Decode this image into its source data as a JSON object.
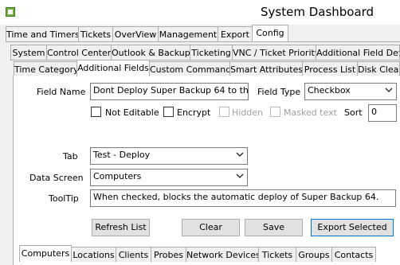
{
  "window": {
    "title": "System Dashboard"
  },
  "main_tabs": [
    {
      "label": "Time and Timers"
    },
    {
      "label": "Tickets"
    },
    {
      "label": "OverView"
    },
    {
      "label": "Management"
    },
    {
      "label": "Export"
    },
    {
      "label": "Config"
    }
  ],
  "config_tabs": [
    {
      "label": "System"
    },
    {
      "label": "Control Center"
    },
    {
      "label": "Outlook & Backup"
    },
    {
      "label": "Ticketing"
    },
    {
      "label": "VNC / Ticket Priority"
    },
    {
      "label": "Additional Field Defa"
    }
  ],
  "system_tabs": [
    {
      "label": "Time Category"
    },
    {
      "label": "Additional Fields"
    },
    {
      "label": "Custom Commands"
    },
    {
      "label": "Smart Attributes"
    },
    {
      "label": "Process List"
    },
    {
      "label": "Disk Clean"
    }
  ],
  "form": {
    "field_name_label": "Field Name",
    "field_name_value": "Dont Deploy Super Backup 64 to this wo",
    "field_type_label": "Field Type",
    "field_type_value": "Checkbox",
    "not_editable_label": "Not Editable",
    "encrypt_label": "Encrypt",
    "hidden_label": "Hidden",
    "masked_text_label": "Masked text",
    "sort_label": "Sort",
    "sort_value": "0",
    "tab_label": "Tab",
    "tab_value": "Test - Deploy",
    "data_screen_label": "Data Screen",
    "data_screen_value": "Computers",
    "tooltip_label": "ToolTip",
    "tooltip_value": "When checked, blocks the automatic deploy of Super Backup 64."
  },
  "buttons": {
    "refresh": "Refresh List",
    "clear": "Clear",
    "save": "Save",
    "export": "Export Selected"
  },
  "bottom_tabs": [
    {
      "label": "Computers"
    },
    {
      "label": "Locations"
    },
    {
      "label": "Clients"
    },
    {
      "label": "Probes"
    },
    {
      "label": "Network Devices"
    },
    {
      "label": "Tickets"
    },
    {
      "label": "Groups"
    },
    {
      "label": "Contacts"
    }
  ]
}
